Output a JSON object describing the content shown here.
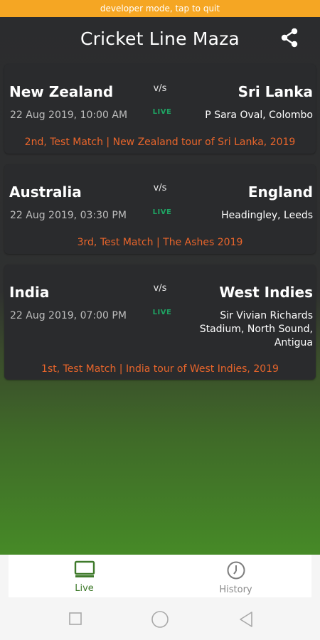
{
  "dev_banner": {
    "text": "developer mode, tap to quit"
  },
  "header": {
    "title": "Cricket Line Maza",
    "share_icon": "share-icon"
  },
  "matches": [
    {
      "team1": "New Zealand",
      "team2": "Sri Lanka",
      "vs": "v/s",
      "datetime": "22 Aug 2019, 10:00 AM",
      "status": "LIVE",
      "venue": "P Sara Oval, Colombo",
      "info": "2nd, Test Match | New Zealand tour of Sri Lanka, 2019"
    },
    {
      "team1": "Australia",
      "team2": "England",
      "vs": "v/s",
      "datetime": "22 Aug 2019, 03:30 PM",
      "status": "LIVE",
      "venue": "Headingley, Leeds",
      "info": "3rd, Test Match | The Ashes 2019"
    },
    {
      "team1": "India",
      "team2": "West Indies",
      "vs": "v/s",
      "datetime": "22 Aug 2019, 07:00 PM",
      "status": "LIVE",
      "venue": "Sir Vivian Richards Stadium, North Sound, Antigua",
      "info": "1st, Test Match | India tour of West Indies, 2019"
    }
  ],
  "bottom_nav": {
    "items": [
      {
        "label": "Live",
        "icon": "tv-icon",
        "active": true
      },
      {
        "label": "History",
        "icon": "clock-icon",
        "active": false
      }
    ]
  },
  "colors": {
    "banner": "#f5a623",
    "live": "#1fa463",
    "match_info": "#e8652b",
    "active_tab": "#3f7a2b"
  }
}
